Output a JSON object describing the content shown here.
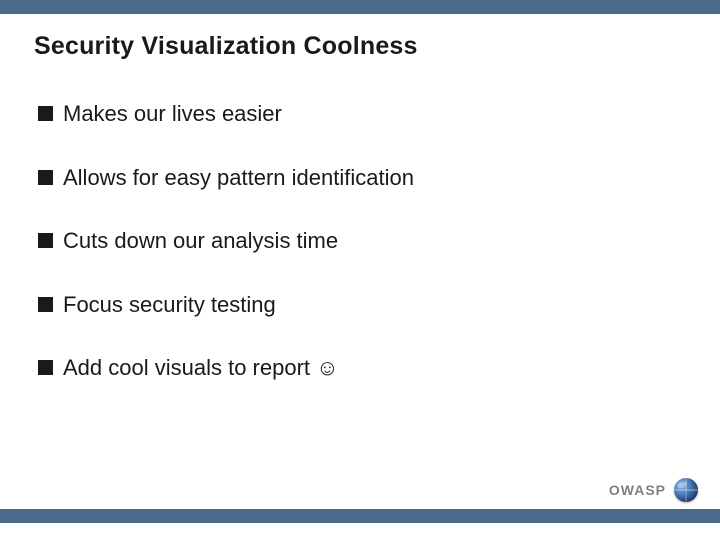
{
  "title": "Security Visualization Coolness",
  "bullets": [
    {
      "text": "Makes our lives easier"
    },
    {
      "text": "Allows for easy pattern identification"
    },
    {
      "text": "Cuts down our analysis time"
    },
    {
      "text": "Focus security testing"
    },
    {
      "text": "Add cool visuals to report ☺"
    }
  ],
  "footer": {
    "org": "OWASP"
  },
  "colors": {
    "bar": "#4a6a8a"
  }
}
